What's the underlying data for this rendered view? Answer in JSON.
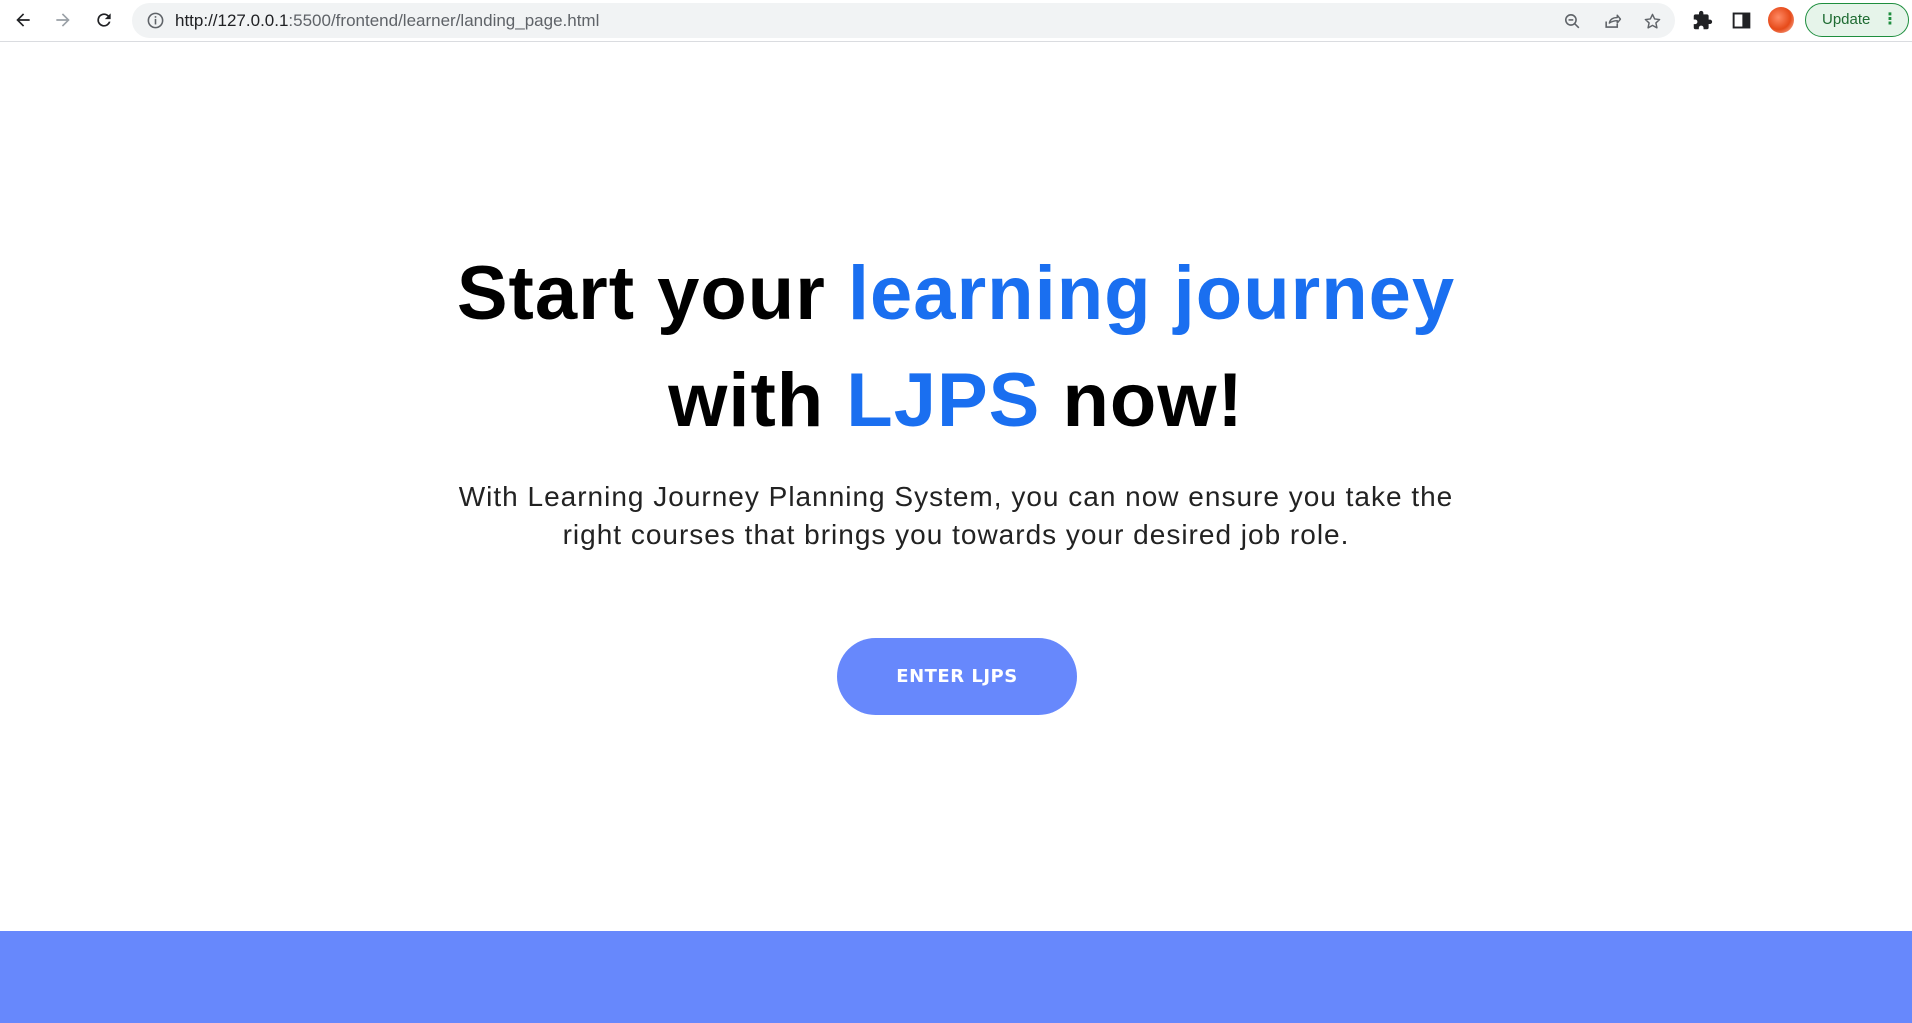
{
  "browser": {
    "url_host": "http://127.0.0.1",
    "url_path": ":5500/frontend/learner/landing_page.html",
    "update_label": "Update",
    "menu_glyph": "⋮"
  },
  "hero": {
    "headline": {
      "part1": "Start your ",
      "part2": "learning journey",
      "part3": " with ",
      "part4": "LJPS",
      "part5": " now!"
    },
    "subtext": "With Learning Journey Planning System, you can now ensure you take the right courses that brings you towards your desired job role.",
    "cta_label": "ENTER LJPS"
  },
  "colors": {
    "accent": "#1a6ff0",
    "button": "#6788fc",
    "footer": "#6788fc"
  }
}
